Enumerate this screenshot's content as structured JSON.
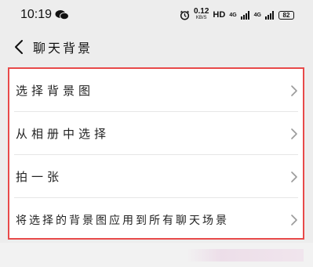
{
  "status_bar": {
    "time": "10:19",
    "app_icon": "wechat-icon",
    "icons": [
      "alarm-icon"
    ],
    "net_speed_value": "0.12",
    "net_speed_unit": "KB/S",
    "hd_label": "HD",
    "signal1_label": "4G",
    "signal2_label": "4G",
    "battery_level": "82"
  },
  "header": {
    "back_icon": "chevron-left-icon",
    "title": "聊天背景"
  },
  "settings": {
    "items": [
      {
        "label": "选择背景图",
        "icon": "chevron-right-icon"
      },
      {
        "label": "从相册中选择",
        "icon": "chevron-right-icon"
      },
      {
        "label": "拍一张",
        "icon": "chevron-right-icon"
      },
      {
        "label": "将选择的背景图应用到所有聊天场景",
        "icon": "chevron-right-icon"
      }
    ]
  },
  "colors": {
    "highlight_border": "#e84a4a",
    "background": "#ededed",
    "card": "#ffffff"
  }
}
